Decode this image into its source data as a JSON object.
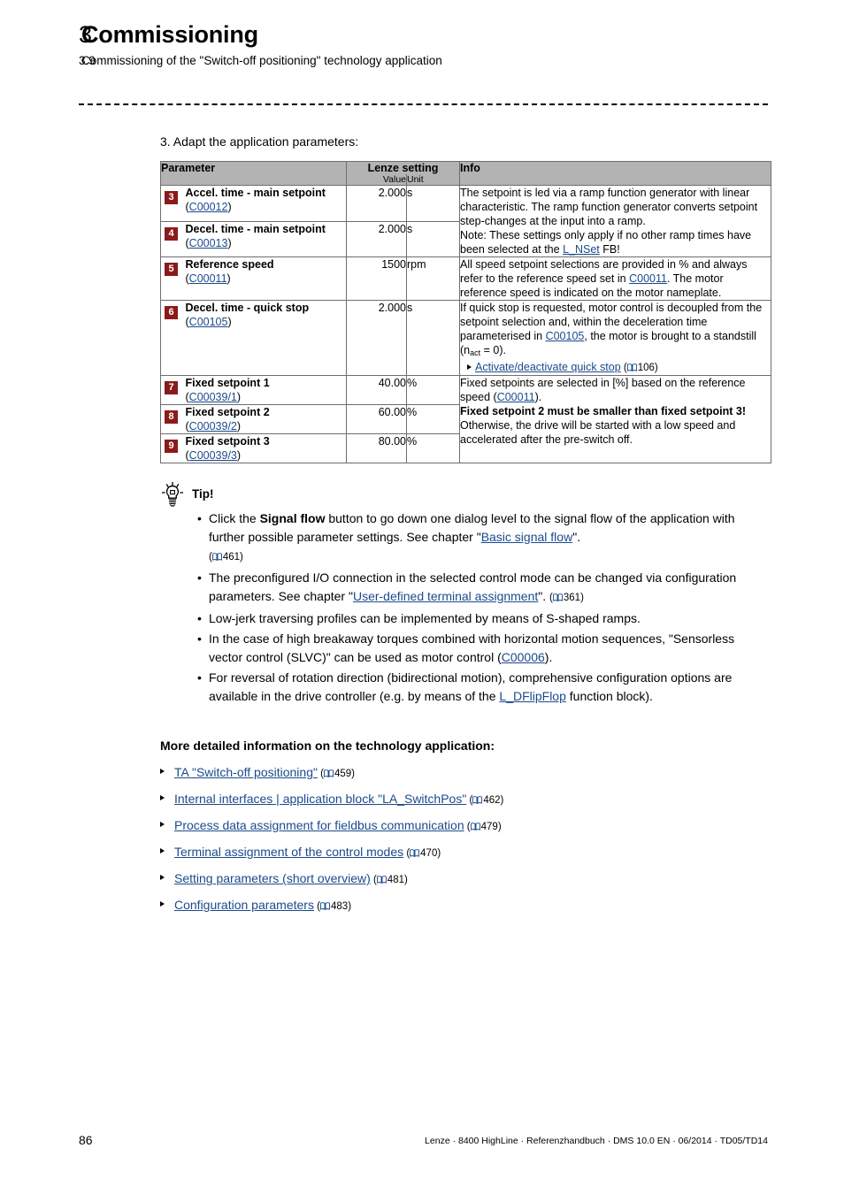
{
  "header": {
    "chapter_number": "3",
    "chapter_title": "Commissioning",
    "section_number": "3.9",
    "section_title": "Commissioning of the \"Switch-off positioning\" technology application"
  },
  "step": {
    "text": "3. Adapt the application parameters:"
  },
  "table": {
    "columns": {
      "parameter": "Parameter",
      "lenze_setting": "Lenze setting",
      "value": "Value",
      "unit": "Unit",
      "info": "Info"
    },
    "rows": [
      {
        "badge": "3",
        "name": "Accel. time - main setpoint",
        "code": "C00012",
        "value": "2.000",
        "unit": "s"
      },
      {
        "badge": "4",
        "name": "Decel. time - main setpoint",
        "code": "C00013",
        "value": "2.000",
        "unit": "s"
      },
      {
        "badge": "5",
        "name": "Reference speed",
        "code": "C00011",
        "value": "1500",
        "unit": "rpm"
      },
      {
        "badge": "6",
        "name": "Decel. time - quick stop",
        "code": "C00105",
        "value": "2.000",
        "unit": "s"
      },
      {
        "badge": "7",
        "name": "Fixed setpoint 1",
        "code": "C00039/1",
        "value": "40.00",
        "unit": "%"
      },
      {
        "badge": "8",
        "name": "Fixed setpoint 2",
        "code": "C00039/2",
        "value": "60.00",
        "unit": "%"
      },
      {
        "badge": "9",
        "name": "Fixed setpoint 3",
        "code": "C00039/3",
        "value": "80.00",
        "unit": "%"
      }
    ],
    "info_cells": {
      "ramp": {
        "part1": "The setpoint is led via a ramp function generator with linear characteristic. The ramp function generator converts setpoint step-changes at the input into a ramp.",
        "part2_pre": "Note: These settings only apply if no other ramp times have been selected at the ",
        "link": "L_NSet",
        "part2_post": " FB!"
      },
      "refspeed": {
        "pre": "All speed setpoint selections are provided in % and always refer to the reference speed set in ",
        "link": "C00011",
        "post": ". The motor reference speed is indicated on the motor nameplate."
      },
      "quickstop": {
        "pre": "If quick stop is requested, motor control is decoupled from the setpoint selection and, within the deceleration time parameterised in ",
        "link": "C00105",
        "mid": ", the motor is brought to a standstill (n",
        "sub": "act",
        "post": " = 0).",
        "ref_link": "Activate/deactivate quick stop",
        "ref_page": "106"
      },
      "fixedsp": {
        "pre": "Fixed setpoints are selected in [%] based on the reference speed (",
        "link": "C00011",
        "post": ").",
        "bold": "Fixed setpoint 2 must be smaller than fixed setpoint 3!",
        "tail": "Otherwise, the drive will be started with a low speed and accelerated after the pre-switch off."
      }
    }
  },
  "tip": {
    "title": "Tip!",
    "items": [
      {
        "pre": "Click the ",
        "bold": "Signal flow",
        "mid": " button to go down one dialog level to the signal flow of the application with further possible parameter settings. See chapter \"",
        "link": "Basic signal flow",
        "post": "\".",
        "page": "461",
        "page_on_newline": true
      },
      {
        "pre": "The preconfigured I/O connection in the selected control mode can be changed via configuration parameters. See chapter \"",
        "link": "User-defined terminal assignment",
        "post": "\". ",
        "page": "361",
        "page_on_newline": false
      },
      {
        "pre": "Low-jerk traversing profiles can be implemented by means of S-shaped ramps.",
        "link": "",
        "post": "",
        "page": "",
        "page_on_newline": false
      },
      {
        "pre": "In the case of high breakaway torques combined with horizontal motion sequences, \"Sensorless vector control (SLVC)\" can be used as motor control (",
        "link": "C00006",
        "post": ").",
        "page": "",
        "page_on_newline": false
      },
      {
        "pre": "For reversal of rotation direction (bidirectional motion), comprehensive configuration options are available in the drive controller (e.g. by means of the ",
        "link": "L_DFlipFlop",
        "post": " function block).",
        "page": "",
        "page_on_newline": false
      }
    ]
  },
  "more_info": {
    "title": "More detailed information on the technology application:",
    "links": [
      {
        "label": "TA \"Switch-off positioning\"",
        "page": "459"
      },
      {
        "label": "Internal interfaces | application block \"LA_SwitchPos\"",
        "page": "462"
      },
      {
        "label": "Process data assignment for fieldbus communication",
        "page": "479"
      },
      {
        "label": "Terminal assignment of the control modes",
        "page": "470"
      },
      {
        "label": "Setting parameters (short overview)",
        "page": "481"
      },
      {
        "label": "Configuration parameters",
        "page": "483"
      }
    ]
  },
  "footer": {
    "page_number": "86",
    "meta": "Lenze · 8400 HighLine · Referenzhandbuch · DMS 10.0 EN · 06/2014 · TD05/TD14"
  },
  "colors": {
    "badge": "#8b1a1a",
    "link": "#1b4a8c",
    "table_header": "#b3b3b3"
  }
}
